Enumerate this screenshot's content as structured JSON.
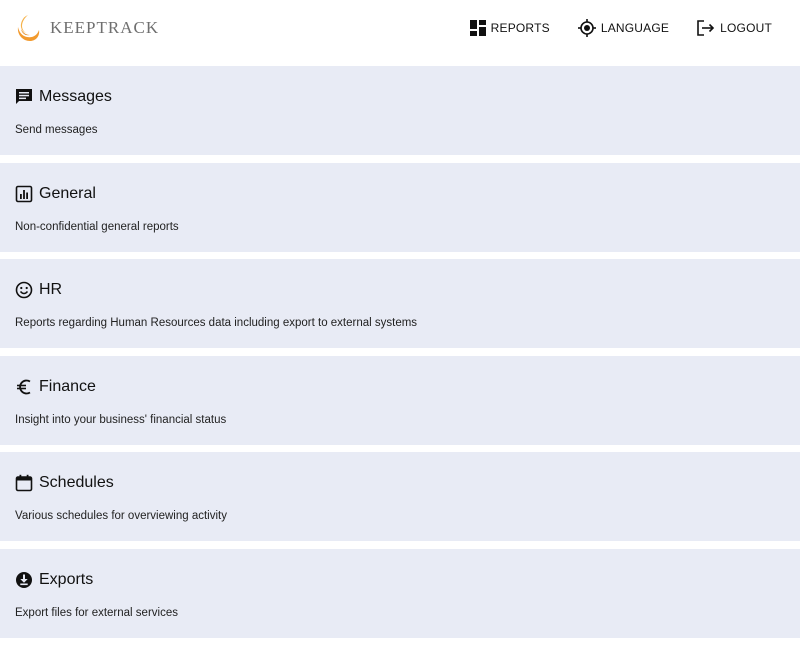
{
  "header": {
    "logo_text": "KEEPTRACK",
    "nav": [
      {
        "label": "REPORTS",
        "icon": "reports-icon"
      },
      {
        "label": "LANGUAGE",
        "icon": "language-icon"
      },
      {
        "label": "LOGOUT",
        "icon": "logout-icon"
      }
    ]
  },
  "cards": [
    {
      "title": "Messages",
      "description": "Send messages",
      "icon": "message-icon"
    },
    {
      "title": "General",
      "description": "Non-confidential general reports",
      "icon": "bar-chart-icon"
    },
    {
      "title": "HR",
      "description": "Reports regarding Human Resources data including export to external systems",
      "icon": "smiley-icon"
    },
    {
      "title": "Finance",
      "description": "Insight into your business' financial status",
      "icon": "euro-icon"
    },
    {
      "title": "Schedules",
      "description": "Various schedules for overviewing activity",
      "icon": "calendar-icon"
    },
    {
      "title": "Exports",
      "description": "Export files for external services",
      "icon": "download-icon"
    }
  ],
  "colors": {
    "card_background": "#e8ebf5",
    "logo_orange": "#f2a33a",
    "logo_text": "#6f6f6f"
  }
}
